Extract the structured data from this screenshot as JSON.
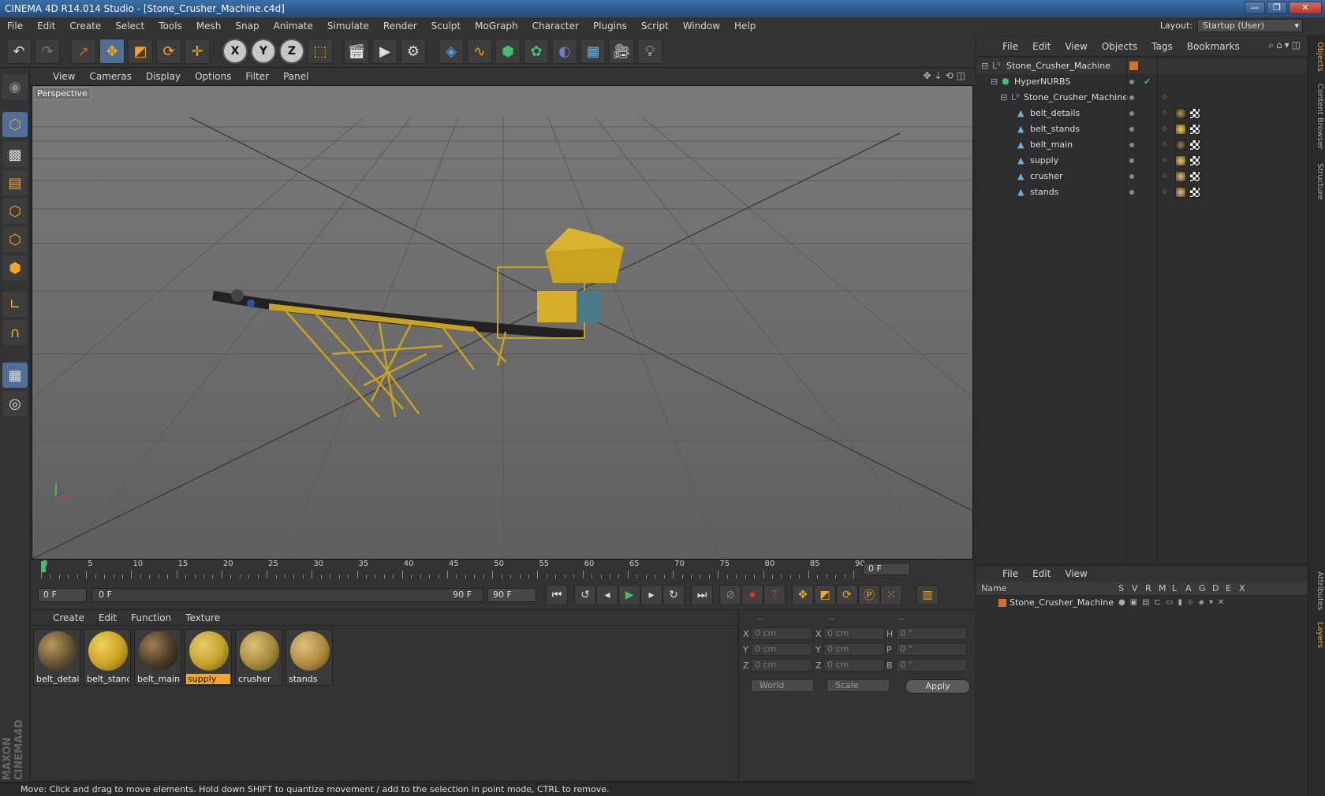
{
  "window": {
    "title": "CINEMA 4D R14.014 Studio - [Stone_Crusher_Machine.c4d]",
    "min": "—",
    "max": "❐",
    "close": "✕"
  },
  "menubar": [
    "File",
    "Edit",
    "Create",
    "Select",
    "Tools",
    "Mesh",
    "Snap",
    "Animate",
    "Simulate",
    "Render",
    "Sculpt",
    "MoGraph",
    "Character",
    "Plugins",
    "Script",
    "Window",
    "Help"
  ],
  "layout": {
    "label": "Layout:",
    "value": "Startup (User)"
  },
  "toolbar": {
    "undo_icon": "undo-icon",
    "redo_icon": "redo-icon",
    "x": "X",
    "y": "Y",
    "z": "Z"
  },
  "viewport": {
    "menu": [
      "View",
      "Cameras",
      "Display",
      "Options",
      "Filter",
      "Panel"
    ],
    "label": "Perspective"
  },
  "timeline": {
    "ticks": [
      "0",
      "5",
      "10",
      "15",
      "20",
      "25",
      "30",
      "35",
      "40",
      "45",
      "50",
      "55",
      "60",
      "65",
      "70",
      "75",
      "80",
      "85",
      "90"
    ],
    "end_field": "0 F"
  },
  "transport": {
    "start": "0 F",
    "range_start": "0 F",
    "range_end": "90 F",
    "end": "90 F"
  },
  "materials": {
    "menu": [
      "Create",
      "Edit",
      "Function",
      "Texture"
    ],
    "items": [
      {
        "name": "belt_detail:",
        "color": "#5a4a30"
      },
      {
        "name": "belt_stand:",
        "color": "#c9a21f"
      },
      {
        "name": "belt_main",
        "color": "#4a3a26"
      },
      {
        "name": "supply",
        "color": "#c4a02a",
        "selected": true
      },
      {
        "name": "crusher",
        "color": "#a8893a"
      },
      {
        "name": "stands",
        "color": "#b08a3e"
      }
    ]
  },
  "coords": {
    "headers": [
      "--",
      "--",
      "--"
    ],
    "rows": [
      {
        "a": "X",
        "av": "0 cm",
        "b": "X",
        "bv": "0 cm",
        "c": "H",
        "cv": "0 °"
      },
      {
        "a": "Y",
        "av": "0 cm",
        "b": "Y",
        "bv": "0 cm",
        "c": "P",
        "cv": "0 °"
      },
      {
        "a": "Z",
        "av": "0 cm",
        "b": "Z",
        "bv": "0 cm",
        "c": "B",
        "cv": "0 °"
      }
    ],
    "world": "World",
    "scale": "Scale",
    "apply": "Apply"
  },
  "objects": {
    "menu": [
      "File",
      "Edit",
      "View",
      "Objects",
      "Tags",
      "Bookmarks"
    ],
    "tree": [
      {
        "name": "Stone_Crusher_Machine",
        "indent": 0,
        "kind": "null"
      },
      {
        "name": "HyperNURBS",
        "indent": 1,
        "kind": "nurbs"
      },
      {
        "name": "Stone_Crusher_Machine",
        "indent": 2,
        "kind": "null"
      },
      {
        "name": "belt_details",
        "indent": 3,
        "kind": "poly"
      },
      {
        "name": "belt_stands",
        "indent": 3,
        "kind": "poly"
      },
      {
        "name": "belt_main",
        "indent": 3,
        "kind": "poly"
      },
      {
        "name": "supply",
        "indent": 3,
        "kind": "poly"
      },
      {
        "name": "crusher",
        "indent": 3,
        "kind": "poly"
      },
      {
        "name": "stands",
        "indent": 3,
        "kind": "poly"
      }
    ]
  },
  "layers": {
    "menu": [
      "File",
      "Edit",
      "View"
    ],
    "header": {
      "name": "Name",
      "cols": [
        "S",
        "V",
        "R",
        "M",
        "L",
        "A",
        "G",
        "D",
        "E",
        "X"
      ]
    },
    "rows": [
      {
        "name": "Stone_Crusher_Machine",
        "color": "#d4702a"
      }
    ]
  },
  "sidetabs": [
    "Objects",
    "Content Browser",
    "Structure",
    "Attributes",
    "Layers"
  ],
  "status": "Move: Click and drag to move elements. Hold down SHIFT to quantize movement / add to the selection in point mode, CTRL to remove.",
  "branding": "MAXON CINEMA4D"
}
